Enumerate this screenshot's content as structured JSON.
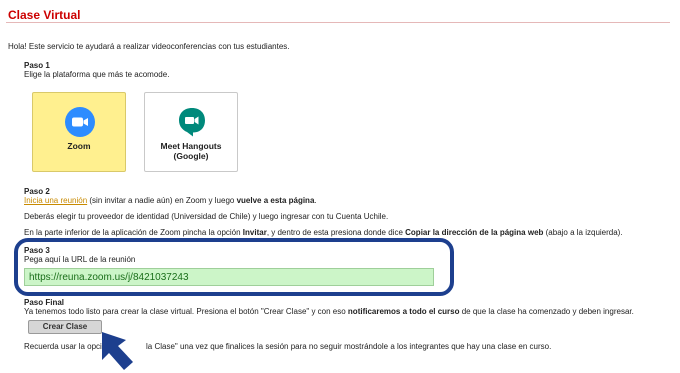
{
  "page": {
    "title": "Clase Virtual",
    "intro": "Hola! Este servicio te ayudará a realizar videoconferencias con tus estudiantes."
  },
  "step1": {
    "heading": "Paso 1",
    "text": "Elige la plataforma que más te acomode.",
    "options": [
      {
        "label": "Zoom",
        "icon": "zoom-video-icon",
        "color": "#2d8cff",
        "selected": true
      },
      {
        "label_line1": "Meet Hangouts",
        "label_line2": "(Google)",
        "icon": "google-meet-icon",
        "color": "#00897b",
        "selected": false
      }
    ]
  },
  "step2": {
    "heading": "Paso 2",
    "link": "Inicia una reunión",
    "line1_mid": " (sin invitar a nadie aún) en Zoom y luego ",
    "line1_bold": "vuelve a esta página",
    "line1_end": ".",
    "line2": "Deberás elegir tu proveedor de identidad (Universidad de Chile) y luego ingresar con tu Cuenta Uchile.",
    "line3_a": "En la parte inferior de la aplicación de Zoom pincha la opción ",
    "line3_b": "Invitar",
    "line3_c": ", y dentro de esta presiona donde dice ",
    "line3_d": "Copiar la dirección de la página web",
    "line3_e": " (abajo a la izquierda)."
  },
  "step3": {
    "heading": "Paso 3",
    "text": "Pega aquí la URL de la reunión",
    "url_value": "https://reuna.zoom.us/j/8421037243"
  },
  "final": {
    "heading": "Paso Final",
    "text_a": "Ya tenemos todo listo para crear la clase virtual. Presiona el botón \"Crear Clase\" y con eso ",
    "text_bold": "notificaremos a todo el curso",
    "text_b": " de que la clase ha comenzado y deben ingresar.",
    "button": "Crear Clase",
    "reminder_a": "Recuerda usar la opción",
    "reminder_b": "la Clase\" una vez que finalices la sesión para no seguir mostrándole a los integrantes que hay una clase en curso."
  },
  "colors": {
    "title": "#cc0000",
    "highlight": "#1d3f8e",
    "input_bg": "#ccf5c8",
    "zoom_card": "#fff08f"
  }
}
